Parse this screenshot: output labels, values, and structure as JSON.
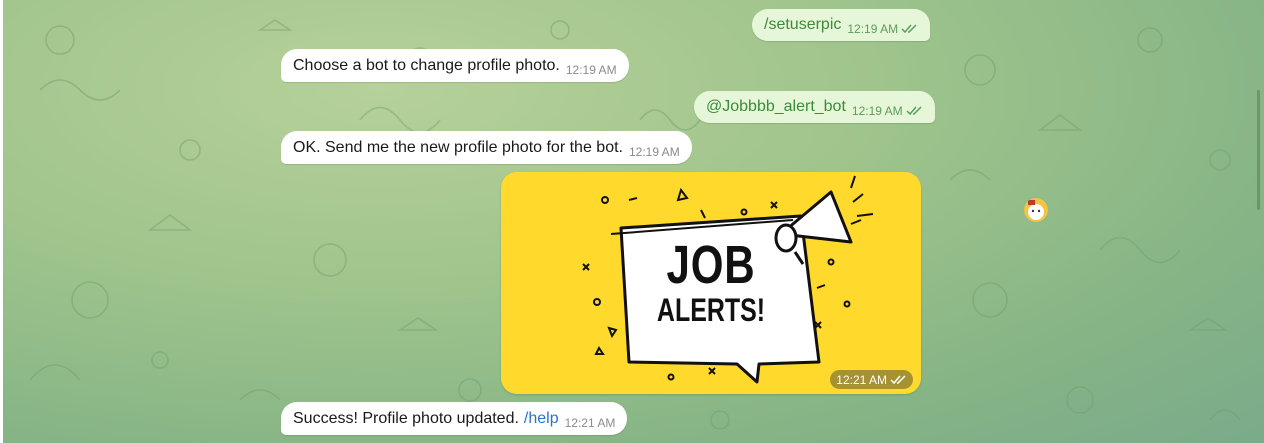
{
  "messages": [
    {
      "text": "/setuserpic",
      "time": "12:19 AM"
    },
    {
      "text": "Choose a bot to change profile photo.",
      "time": "12:19 AM"
    },
    {
      "text": "@Jobbbb_alert_bot",
      "time": "12:19 AM"
    },
    {
      "text": "OK. Send me the new profile photo for the bot.",
      "time": "12:19 AM"
    },
    {
      "image_line1": "JOB",
      "image_line2": "ALERTS!",
      "time": "12:21 AM"
    },
    {
      "text": "Success! Profile photo updated.",
      "link": "/help",
      "time": "12:21 AM"
    }
  ],
  "colors": {
    "incoming_bubble": "#ffffff",
    "outgoing_bubble": "#e6f7d9",
    "outgoing_text": "#3c8a3a",
    "link": "#2d74c4",
    "image_bg": "#ffd92b"
  },
  "icons": [
    "double-check-icon",
    "megaphone-icon",
    "bot-avatar-icon"
  ]
}
